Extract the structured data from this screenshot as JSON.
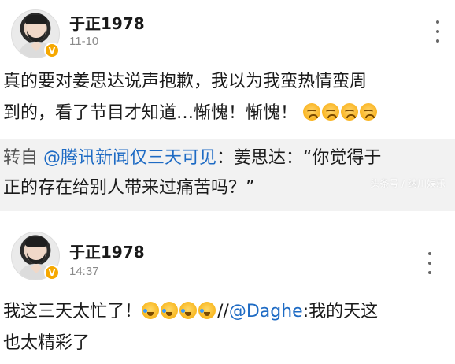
{
  "posts": [
    {
      "username": "于正1978",
      "time": "11-10",
      "line1": "真的要对姜思达说声抱歉，我以为我蛮热情蛮周",
      "line2": "到的，看了节目才知道…惭愧！惭愧！",
      "emoji_icons": [
        "sad-face-icon",
        "sad-face-icon",
        "sad-face-icon",
        "sad-face-icon"
      ],
      "repost": {
        "lead": "转自 ",
        "mention": "@腾讯新闻仅三天可见",
        "line1_rest": "：姜思达：“你觉得于",
        "line2": "正的存在给别人带来过痛苦吗？”",
        "watermark": "头条号 / 纳川娱乐"
      }
    },
    {
      "username": "于正1978",
      "time": "14:37",
      "line1_before": "我这三天太忙了！",
      "emoji_icons": [
        "laughing-crying-icon",
        "laughing-crying-icon",
        "laughing-crying-icon",
        "laughing-crying-icon"
      ],
      "line1_sep": "//",
      "mention": "@Daghe",
      "line1_after": ":我的天这",
      "line2": "也太精彩了"
    }
  ],
  "colors": {
    "mention": "#1e6bc4",
    "vip_badge": "#f6a800",
    "repost_bg": "#f2f2f2"
  },
  "vip_badge_text": "V"
}
